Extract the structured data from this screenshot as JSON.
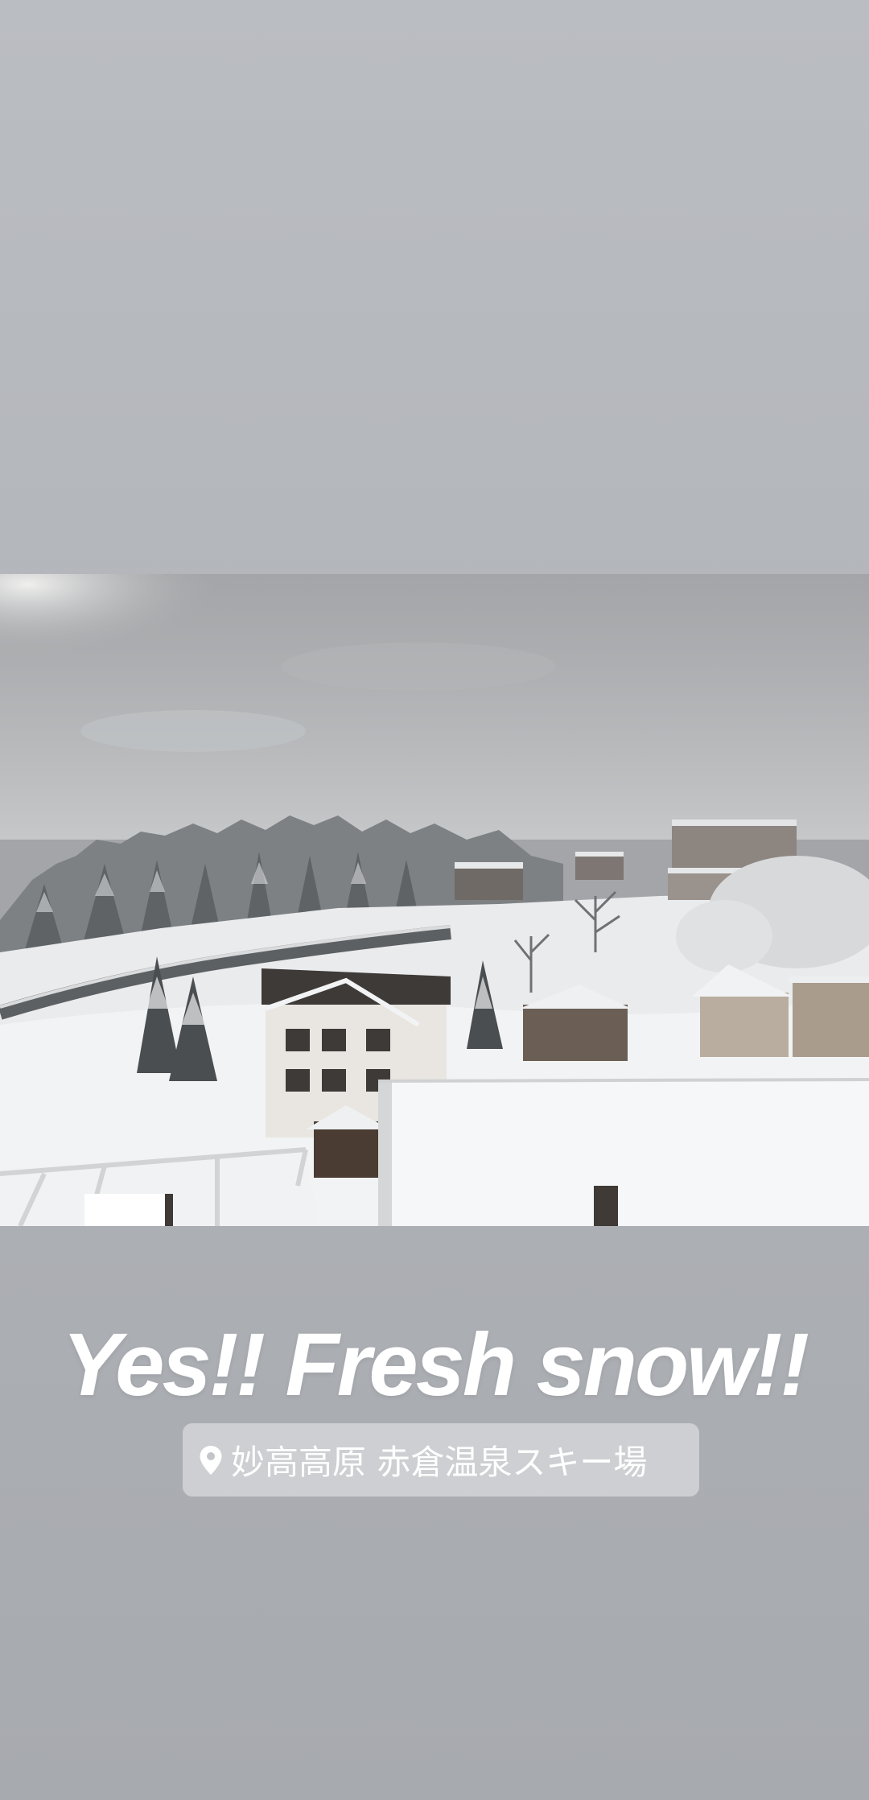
{
  "story": {
    "photo": {
      "subject": "snow-covered-ski-resort-village"
    },
    "caption": {
      "text": "Yes!! Fresh snow!!",
      "color": "#ffffff"
    },
    "location_sticker": {
      "icon": "location-pin-icon",
      "label": "妙高高原 赤倉温泉スキー場",
      "background": "#dcdde0"
    }
  }
}
